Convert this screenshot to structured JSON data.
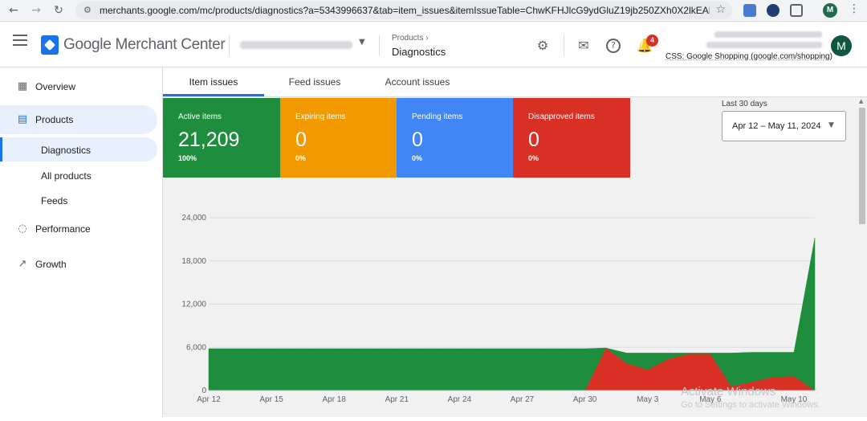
{
  "browser": {
    "url": "merchants.google.com/mc/products/diagnostics?a=5343996637&tab=item_issues&itemIssueTable=ChwKFHJlcG9ydGluZ19jb250ZXh0X2lkEAEaAhAmCg0...",
    "profile_initial": "M"
  },
  "header": {
    "app_name": "Google Merchant Center",
    "breadcrumb_parent": "Products",
    "breadcrumb_current": "Diagnostics",
    "notification_count": "4",
    "css_label": "CSS: Google Shopping (google.com/shopping)",
    "avatar_initial": "M"
  },
  "sidebar": {
    "items": [
      {
        "label": "Overview",
        "icon": "dashboard-icon"
      },
      {
        "label": "Products",
        "icon": "list-icon"
      },
      {
        "label": "Diagnostics"
      },
      {
        "label": "All products"
      },
      {
        "label": "Feeds"
      },
      {
        "label": "Performance",
        "icon": "donut-icon"
      },
      {
        "label": "Growth",
        "icon": "trending-icon"
      }
    ]
  },
  "tabs": [
    "Item issues",
    "Feed issues",
    "Account issues"
  ],
  "cards": [
    {
      "title": "Active items",
      "value": "21,209",
      "pct": "100%",
      "color": "#1e8e3e"
    },
    {
      "title": "Expiring items",
      "value": "0",
      "pct": "0%",
      "color": "#f29900"
    },
    {
      "title": "Pending items",
      "value": "0",
      "pct": "0%",
      "color": "#4285f4"
    },
    {
      "title": "Disapproved items",
      "value": "0",
      "pct": "0%",
      "color": "#d93025"
    }
  ],
  "date_range": {
    "label": "Last 30 days",
    "value": "Apr 12 – May 11, 2024"
  },
  "watermark": {
    "line1": "Activate Windows",
    "line2": "Go to Settings to activate Windows."
  },
  "chart_data": {
    "type": "area",
    "x": [
      "Apr 12",
      "Apr 13",
      "Apr 14",
      "Apr 15",
      "Apr 16",
      "Apr 17",
      "Apr 18",
      "Apr 19",
      "Apr 20",
      "Apr 21",
      "Apr 22",
      "Apr 23",
      "Apr 24",
      "Apr 25",
      "Apr 26",
      "Apr 27",
      "Apr 28",
      "Apr 29",
      "Apr 30",
      "May 1",
      "May 2",
      "May 3",
      "May 4",
      "May 5",
      "May 6",
      "May 7",
      "May 8",
      "May 9",
      "May 10",
      "May 11"
    ],
    "x_tick_labels": [
      "Apr 12",
      "Apr 15",
      "Apr 18",
      "Apr 21",
      "Apr 24",
      "Apr 27",
      "Apr 30",
      "May 3",
      "May 6",
      "May 10"
    ],
    "y_ticks": [
      "0",
      "6,000",
      "12,000",
      "18,000",
      "24,000"
    ],
    "ylim": [
      0,
      24000
    ],
    "series": [
      {
        "name": "Disapproved items",
        "color": "#d93025",
        "values": [
          0,
          0,
          0,
          0,
          0,
          0,
          0,
          0,
          0,
          0,
          0,
          0,
          0,
          0,
          0,
          0,
          0,
          0,
          0,
          5900,
          3800,
          2900,
          4400,
          5100,
          5100,
          600,
          1200,
          1900,
          2000,
          0
        ]
      },
      {
        "name": "Active items",
        "color": "#1e8e3e",
        "values": [
          5800,
          5800,
          5800,
          5800,
          5800,
          5800,
          5800,
          5800,
          5800,
          5800,
          5800,
          5800,
          5800,
          5800,
          5800,
          5800,
          5800,
          5800,
          5800,
          0,
          1400,
          2300,
          800,
          100,
          100,
          4600,
          4100,
          3400,
          3300,
          21209
        ]
      }
    ],
    "grid": true,
    "legend": "none"
  }
}
